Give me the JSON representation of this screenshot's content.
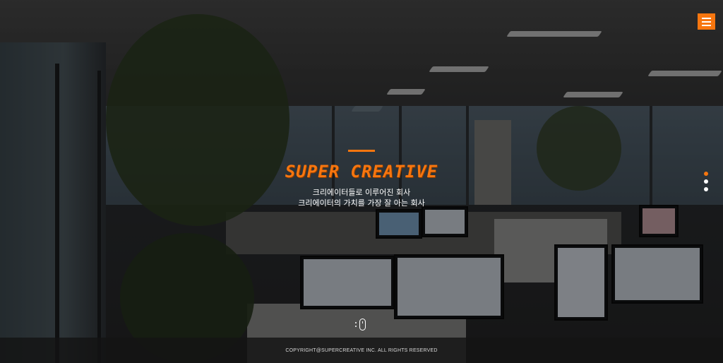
{
  "header": {
    "menu_icon": "hamburger-menu-icon",
    "menu_color": "#f7760f"
  },
  "hero": {
    "title": "SUPER CREATIVE",
    "subtitle_line1": "크리에이터들로 이루어진 회사",
    "subtitle_line2": "크리에이터의 가치를 가장 잘 아는 회사",
    "accent_color": "#f7760f"
  },
  "pagination": {
    "count": 3,
    "active_index": 0
  },
  "scroll_hint": {
    "icon": "mouse-scroll-icon"
  },
  "footer": {
    "copyright": "COPYRIGHT@SUPERCREATIVE INC. ALL RIGHTS RESERVED"
  }
}
